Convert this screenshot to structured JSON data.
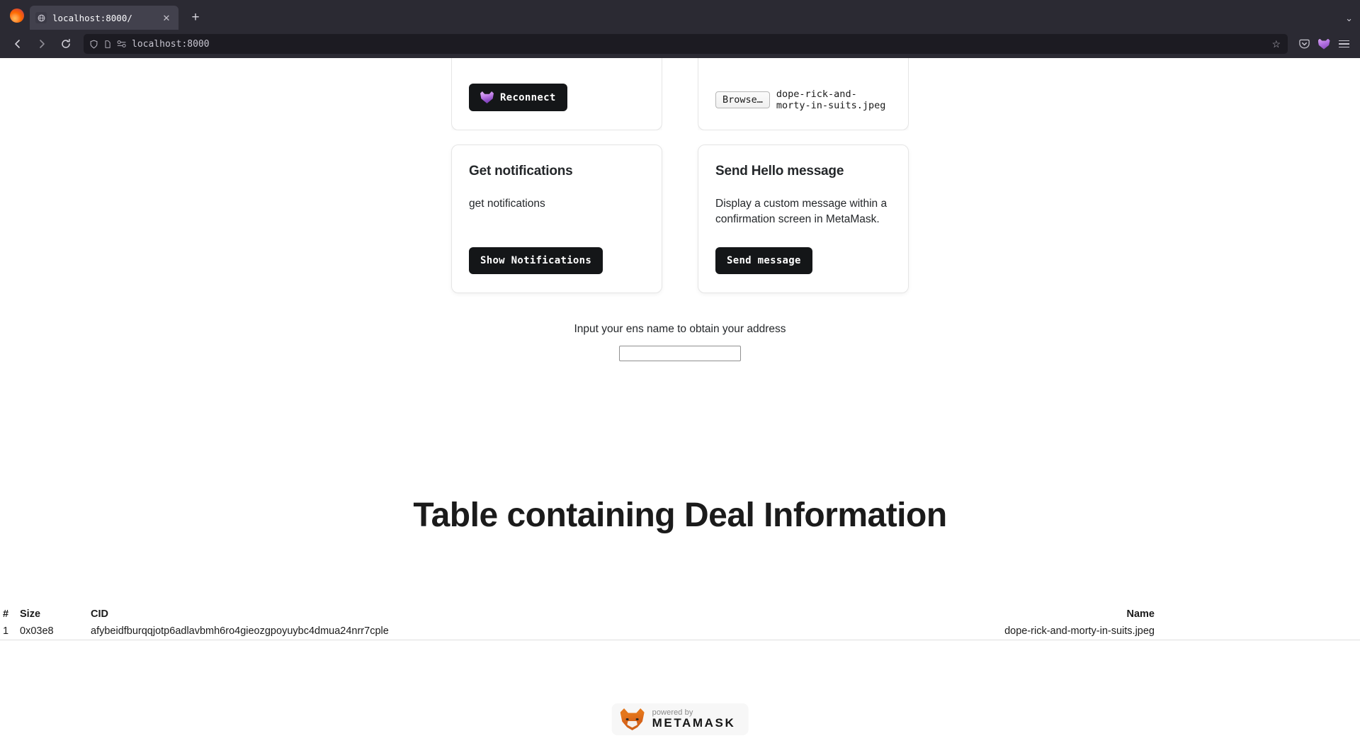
{
  "browser": {
    "tab": {
      "title": "localhost:8000/",
      "favicon_icon": "globe-icon",
      "close_icon": "✕"
    },
    "newtab_icon": "+",
    "window_chevron_icon": "⌄",
    "back_icon": "←",
    "forward_icon": "→",
    "reload_icon": "⟳",
    "url": "localhost:8000",
    "shield_icon": "shield-icon",
    "page-info_icon": "page-icon",
    "permissions_icon": "permissions-icon",
    "bookmark_star_icon": "☆",
    "save-to-pocket_icon": "pocket-icon",
    "extension_icon": "metamask-extension-icon",
    "app-menu_icon": "hamburger-icon"
  },
  "main": {
    "cards_top": [
      {
        "id": "reconnect",
        "button_label": "Reconnect",
        "button_icon": "metamask-fox-icon"
      },
      {
        "id": "file-upload",
        "browse_label": "Browse…",
        "file_name": "dope-rick-and-morty-in-suits.jpeg"
      }
    ],
    "cards": [
      {
        "id": "get-notifications",
        "title": "Get notifications",
        "description": "get notifications",
        "button_label": "Show Notifications"
      },
      {
        "id": "send-hello-message",
        "title": "Send Hello message",
        "description": "Display a custom message within a confirmation screen in MetaMask.",
        "button_label": "Send message"
      }
    ],
    "ens": {
      "label": "Input your ens name to obtain your address",
      "value": "",
      "placeholder": ""
    },
    "table_heading": "Table containing Deal Information",
    "table": {
      "columns": [
        "#",
        "Size",
        "CID",
        "Name"
      ],
      "rows": [
        {
          "num": "1",
          "size": "0x03e8",
          "cid": "afybeidfburqqjotp6adlavbmh6ro4gieozgpoyuybc4dmua24nrr7cple",
          "name": "dope-rick-and-morty-in-suits.jpeg"
        }
      ]
    }
  },
  "footer": {
    "powered_by": "powered by",
    "brand": "METAMASK",
    "logo_icon": "metamask-fox-icon"
  },
  "colors": {
    "chrome_bg": "#2b2a33",
    "urlbar_bg": "#1c1b22",
    "button_dark": "#141618",
    "text_primary": "#24272a",
    "metamask_orange": "#e2761b"
  }
}
